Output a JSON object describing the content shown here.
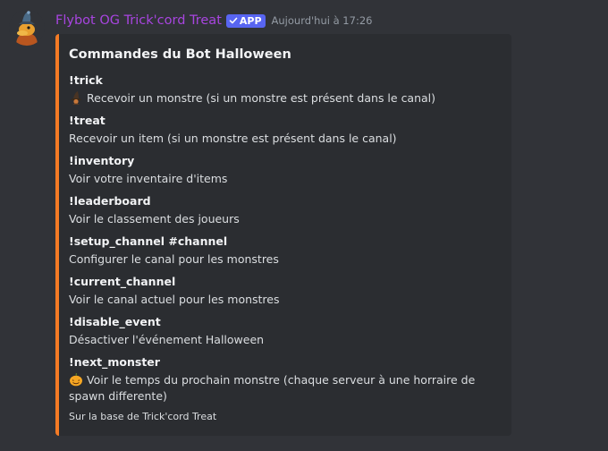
{
  "message": {
    "author": "Flybot OG Trick'cord Treat",
    "badge": "APP",
    "timestamp": "Aujourd'hui à 17:26",
    "avatar_icon": "witch-duck-avatar"
  },
  "embed": {
    "accent_color": "#f57b25",
    "title": "Commandes du Bot Halloween",
    "fields": [
      {
        "name": "!trick",
        "value": "Recevoir un monstre (si un monstre est présent dans le canal)",
        "emoji": "witch-icon"
      },
      {
        "name": "!treat",
        "value": "Recevoir un item (si un monstre est présent dans le canal)"
      },
      {
        "name": "!inventory",
        "value": "Voir votre inventaire d'items"
      },
      {
        "name": "!leaderboard",
        "value": "Voir le classement des joueurs"
      },
      {
        "name": "!setup_channel #channel",
        "value": "Configurer le canal pour les monstres"
      },
      {
        "name": "!current_channel",
        "value": "Voir le canal actuel pour les monstres"
      },
      {
        "name": "!disable_event",
        "value": "Désactiver l'événement Halloween"
      },
      {
        "name": "!next_monster",
        "value": "Voir le temps du prochain monstre (chaque serveur à une horraire de spawn differente)",
        "emoji": "pumpkin-icon"
      }
    ],
    "footer": "Sur la base de Trick'cord Treat"
  },
  "colors": {
    "background": "#313338",
    "embed_background": "#2b2d31",
    "username": "#a845e0",
    "badge": "#5865f2"
  }
}
